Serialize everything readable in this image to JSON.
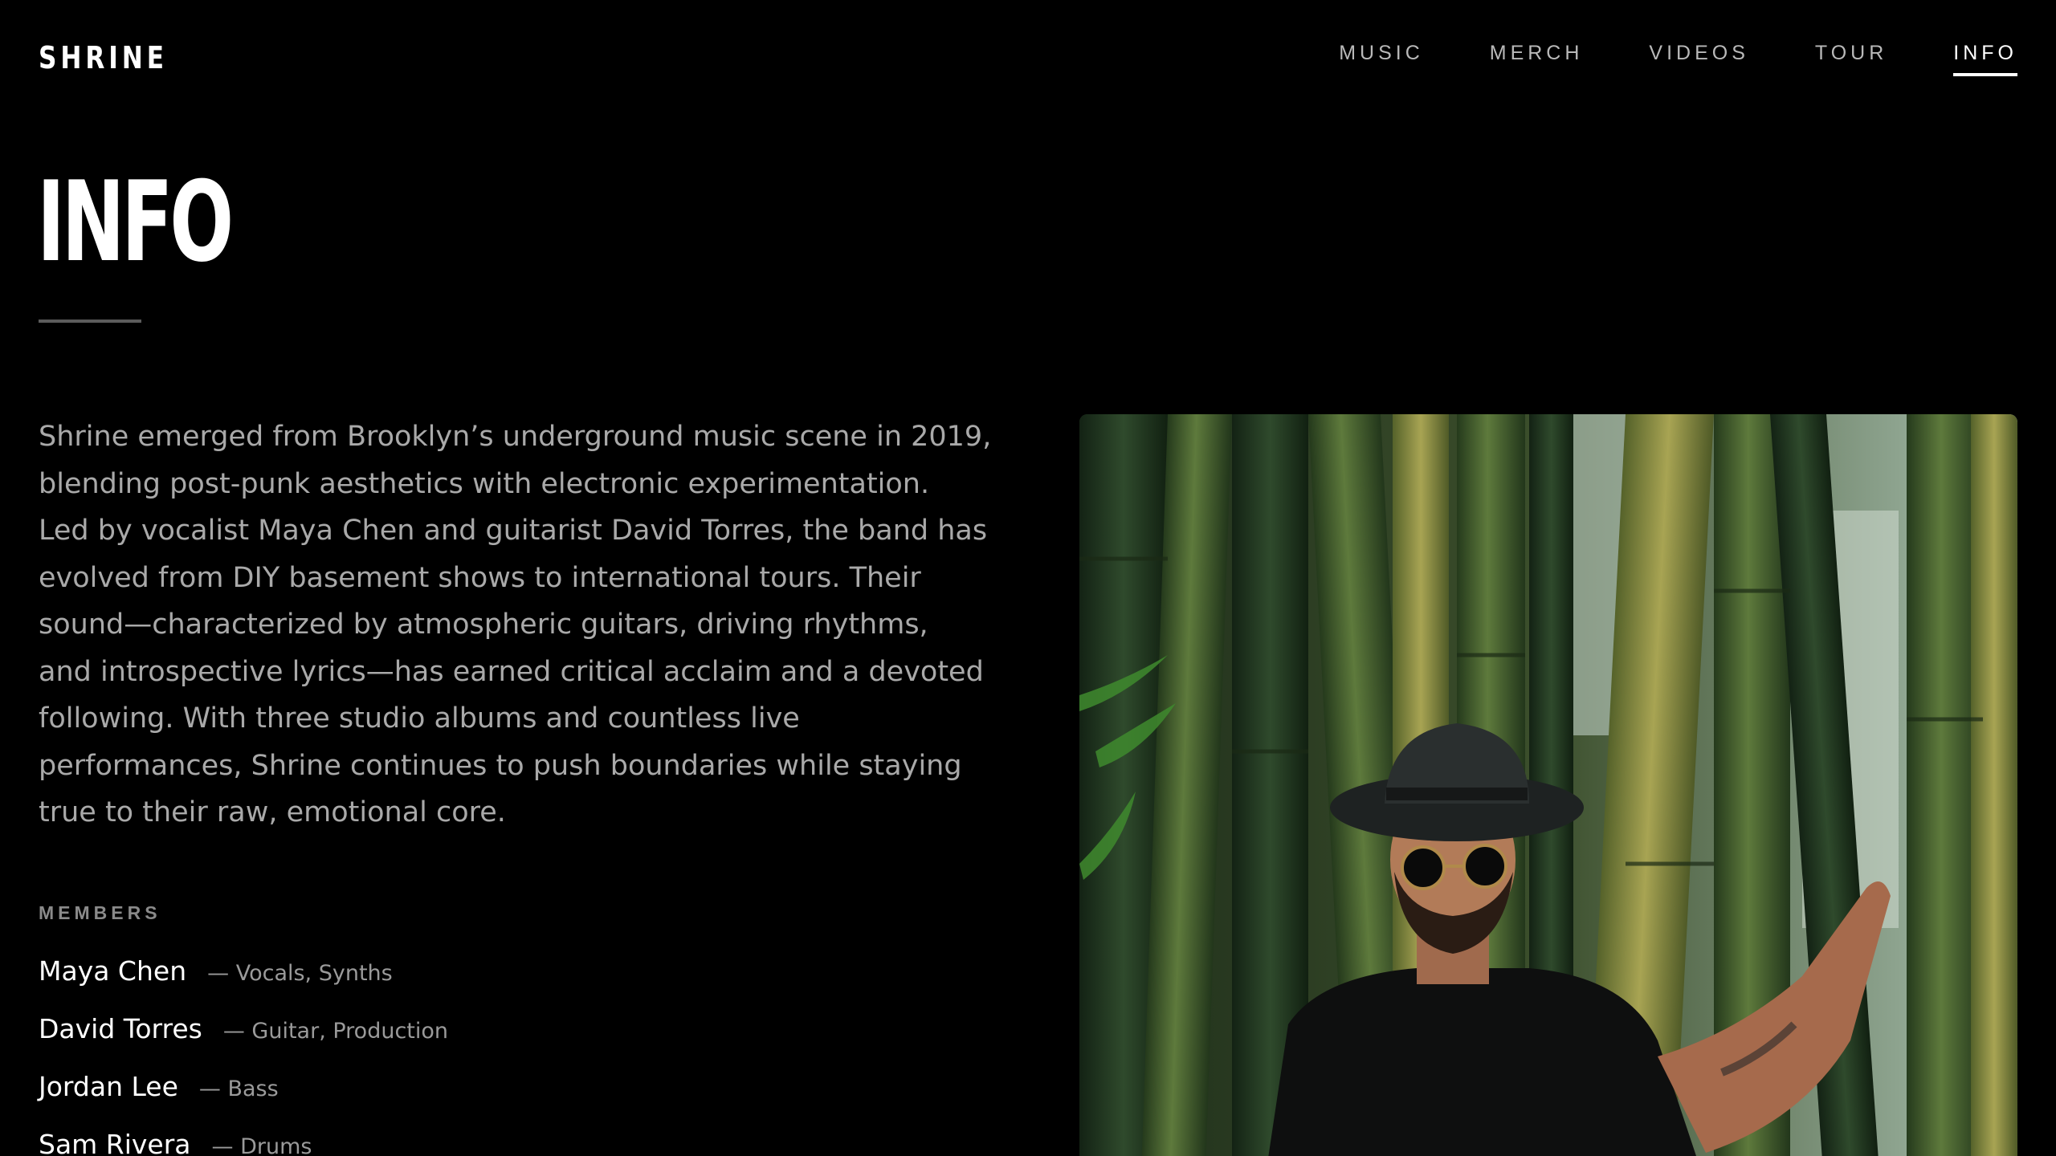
{
  "header": {
    "logo": "SHRINE",
    "nav": [
      {
        "label": "MUSIC",
        "active": false
      },
      {
        "label": "MERCH",
        "active": false
      },
      {
        "label": "VIDEOS",
        "active": false
      },
      {
        "label": "TOUR",
        "active": false
      },
      {
        "label": "INFO",
        "active": true
      }
    ]
  },
  "main": {
    "title": "INFO",
    "bio_lines": [
      "Shrine emerged from Brooklyn’s underground music scene in 2019,",
      "blending post-punk aesthetics with electronic experimentation.",
      "Led by vocalist Maya Chen and guitarist David Torres, the band has",
      "evolved from DIY basement shows to international tours. Their",
      "sound—characterized by atmospheric guitars, driving rhythms,",
      "and introspective lyrics—has earned critical acclaim and a devoted",
      "following. With three studio albums and countless live",
      "performances, Shrine continues to push boundaries while staying",
      "true to their raw, emotional core."
    ],
    "members_heading": "MEMBERS",
    "members": [
      {
        "name": "Maya Chen",
        "role": "— Vocals, Synths"
      },
      {
        "name": "David Torres",
        "role": "— Guitar, Production"
      },
      {
        "name": "Jordan Lee",
        "role": "— Bass"
      },
      {
        "name": "Sam Rivera",
        "role": "— Drums"
      }
    ]
  },
  "colors": {
    "background": "#000000",
    "text": "#ffffff",
    "muted_text": "#a9a9a9",
    "nav_inactive": "#b9b9b9",
    "rule": "#5c5c5c"
  }
}
